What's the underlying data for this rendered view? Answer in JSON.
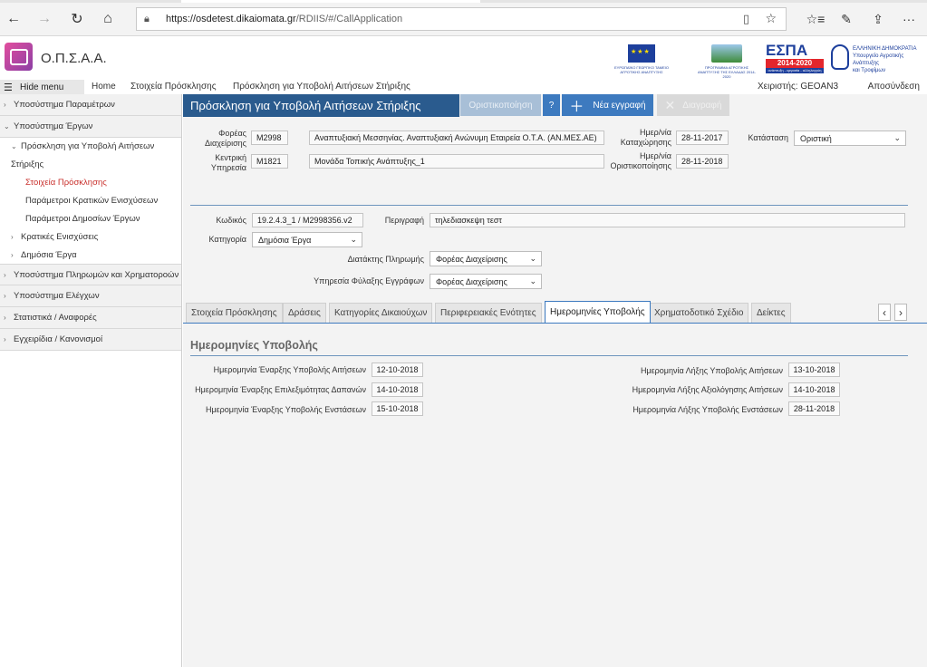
{
  "browser": {
    "back_icon": "←",
    "forward_icon": "→",
    "reload_icon": "↻",
    "home_icon": "⌂",
    "url_host": "https://osdetest.dikaiomata.gr",
    "url_path": "/RDIIS/#/CallApplication",
    "reading_icon": "▯",
    "star_icon": "☆",
    "favorites_icon": "☆≡",
    "pen_icon": "✎",
    "share_icon": "⇪",
    "more_icon": "···"
  },
  "app": {
    "title": "Ο.Π.Σ.Α.Α.",
    "logos": {
      "eu_caption": "ΕΥΡΩΠΑΪΚΟ ΓΕΩΡΓΙΚΟ ΤΑΜΕΙΟ ΑΓΡΟΤΙΚΗΣ ΑΝΑΠΤΥΞΗΣ",
      "prog_caption": "ΠΡΟΓΡΑΜΜΑ ΑΓΡΟΤΙΚΗΣ ΑΝΑΠΤΥΞΗΣ ΤΗΣ ΕΛΛΑΔΑΣ 2014-2020",
      "espa_title": "ΕΣΠΑ",
      "espa_years": "2014-2020",
      "espa_tag": "ανάπτυξη - εργασία - αλληλεγγύη",
      "gov_line1": "ΕΛΛΗΝΙΚΗ ΔΗΜΟΚΡΑΤΙΑ",
      "gov_line2": "Υπουργείο Αγροτικής Ανάπτυξης",
      "gov_line3": "και Τροφίμων"
    }
  },
  "menubar": {
    "hide_label": "Hide menu",
    "home": "Home",
    "crumb1": "Στοιχεία Πρόσκλησης",
    "crumb2": "Πρόσκληση για Υποβολή Αιτήσεων Στήριξης",
    "user": "Χειριστής: GEOAN3",
    "logout": "Αποσύνδεση"
  },
  "sidebar": {
    "item1": "Υποσύστημα Παραμέτρων",
    "item2": "Υποσύστημα Έργων",
    "item2a_line1": "Πρόσκληση για Υποβολή Αιτήσεων",
    "item2a_line2": "Στήριξης",
    "item2a_i": "Στοιχεία Πρόσκλησης",
    "item2a_ii": "Παράμετροι Κρατικών Ενισχύσεων",
    "item2a_iii": "Παράμετροι Δημοσίων Έργων",
    "item2b": "Κρατικές Ενισχύσεις",
    "item2c": "Δημόσια Έργα",
    "item3": "Υποσύστημα Πληρωμών και Χρηματοροών",
    "item4": "Υποσύστημα Ελέγχων",
    "item5": "Στατιστικά / Αναφορές",
    "item6": "Εγχειρίδια / Κανονισμοί"
  },
  "form": {
    "title": "Πρόσκληση για Υποβολή Αιτήσεων Στήριξης",
    "btn_finalize": "Οριστικοποίηση",
    "btn_help": "?",
    "btn_new": "Νέα εγγραφή",
    "btn_delete": "Διαγραφή",
    "foreas_label": "Φορέας Διαχείρισης",
    "foreas_code": "M2998",
    "foreas_name": "Αναπτυξιακή Μεσσηνίας. Αναπτυξιακή Ανώνυμη Εταιρεία Ο.Τ.Α. (ΑΝ.ΜΕΣ.ΑΕ)",
    "kentriki_label": "Κεντρική Υπηρεσία",
    "kentriki_code": "M1821",
    "kentriki_name": "Μονάδα Τοπικής Ανάπτυξης_1",
    "date_reg_label": "Ημερ/νία Καταχώρησης",
    "date_reg": "28-11-2017",
    "date_fin_label": "Ημερ/νία Οριστικοποίησης",
    "date_fin": "28-11-2018",
    "status_label": "Κατάσταση",
    "status_value": "Οριστική",
    "kodikos_label": "Κωδικός",
    "kodikos": "19.2.4.3_1 / M2998356.v2",
    "perigrafi_label": "Περιγραφή",
    "perigrafi": "τηλεδιασκεψη τεστ",
    "katigoria_label": "Κατηγορία",
    "katigoria": "Δημόσια Έργα",
    "diatak_label": "Διατάκτης Πληρωμής",
    "diatak": "Φορέας Διαχείρισης",
    "ypiresia_label": "Υπηρεσία Φύλαξης Εγγράφων",
    "ypiresia": "Φορέας Διαχείρισης"
  },
  "tabs": [
    "Στοιχεία Πρόσκλησης",
    "Δράσεις",
    "Κατηγορίες Δικαιούχων",
    "Περιφερειακές Ενότητες",
    "Ημερομηνίες Υποβολής",
    "Χρηματοδοτικό Σχέδιο",
    "Δείκτες"
  ],
  "dates": {
    "section_title": "Ημερομηνίες Υποβολής",
    "start_sub_label": "Ημερομηνία Έναρξης Υποβολής Αιτήσεων",
    "start_sub": "12-10-2018",
    "start_elig_label": "Ημερομηνία Έναρξης Επιλεξιμότητας Δαπανών",
    "start_elig": "14-10-2018",
    "start_obj_label": "Ημερομηνία Έναρξης Υποβολής Ενστάσεων",
    "start_obj": "15-10-2018",
    "end_sub_label": "Ημερομηνία Λήξης Υποβολής Αιτήσεων",
    "end_sub": "13-10-2018",
    "end_eval_label": "Ημερομηνία Λήξης Αξιολόγησης Αιτήσεων",
    "end_eval": "14-10-2018",
    "end_obj_label": "Ημερομηνία Λήξης Υποβολής Ενστάσεων",
    "end_obj": "28-11-2018"
  }
}
